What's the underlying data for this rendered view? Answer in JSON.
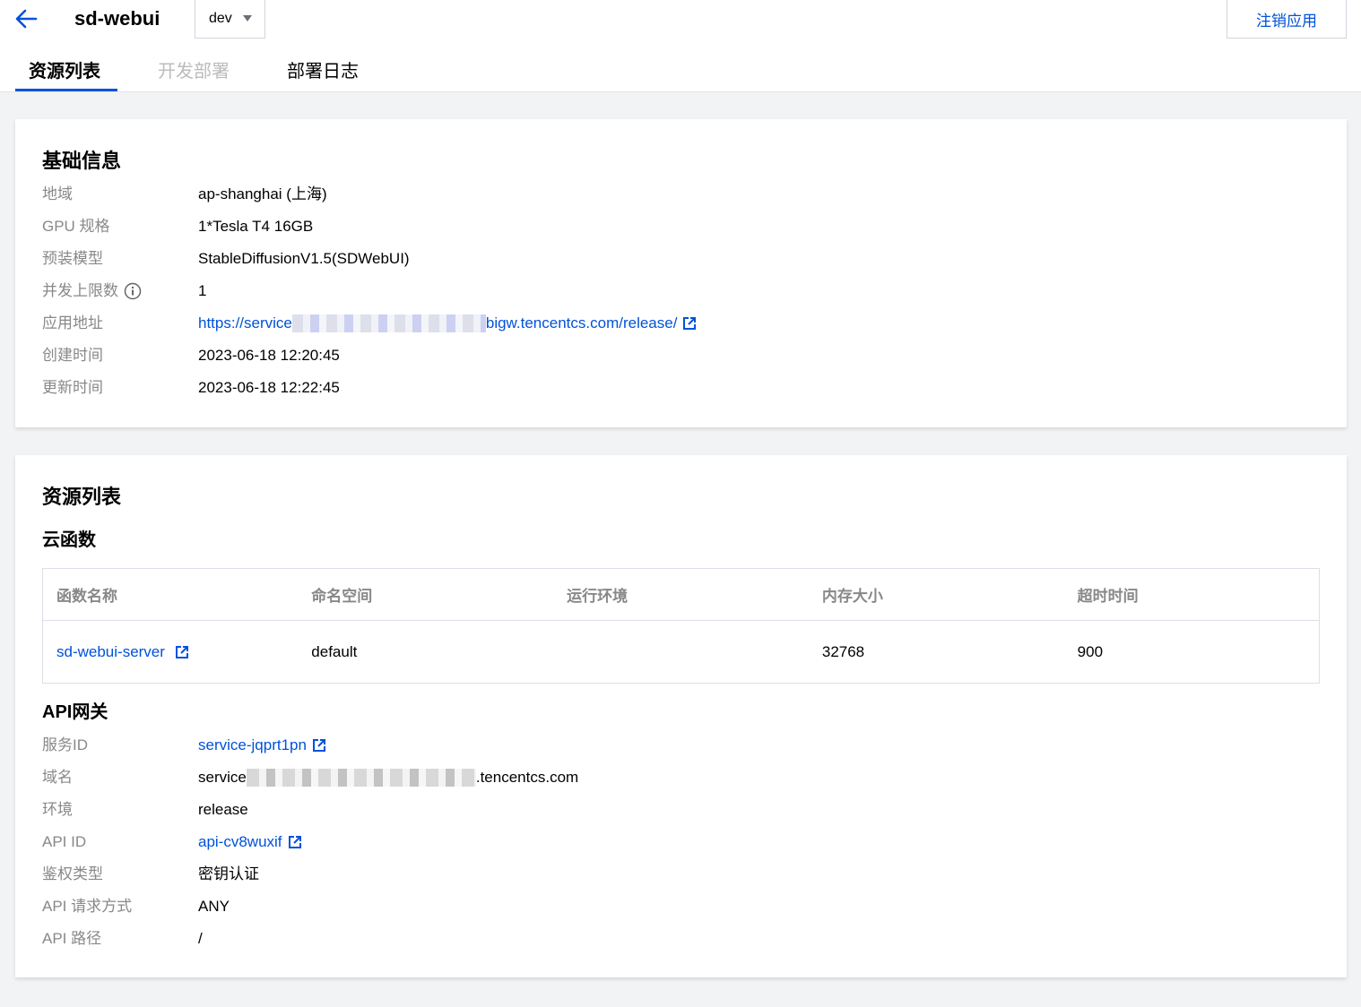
{
  "header": {
    "app_name": "sd-webui",
    "env_selected": "dev",
    "logout_label": "注销应用",
    "tabs": [
      {
        "label": "资源列表",
        "state": "active"
      },
      {
        "label": "开发部署",
        "state": "disabled"
      },
      {
        "label": "部署日志",
        "state": "normal"
      }
    ]
  },
  "basic_info": {
    "title": "基础信息",
    "rows": [
      {
        "label": "地域",
        "value": "ap-shanghai (上海)"
      },
      {
        "label": "GPU 规格",
        "value": "1*Tesla T4 16GB"
      },
      {
        "label": "预装模型",
        "value": "StableDiffusionV1.5(SDWebUI)"
      },
      {
        "label": "并发上限数",
        "value": "1"
      },
      {
        "label": "应用地址",
        "value_prefix": "https://service",
        "value_suffix": "bigw.tencentcs.com/release/"
      },
      {
        "label": "创建时间",
        "value": "2023-06-18 12:20:45"
      },
      {
        "label": "更新时间",
        "value": "2023-06-18 12:22:45"
      }
    ]
  },
  "resources": {
    "title": "资源列表",
    "cloud_function": {
      "title": "云函数",
      "columns": [
        "函数名称",
        "命名空间",
        "运行环境",
        "内存大小",
        "超时时间"
      ],
      "rows": [
        {
          "name": "sd-webui-server",
          "namespace": "default",
          "runtime": "",
          "memory": "32768",
          "timeout": "900"
        }
      ]
    },
    "api_gateway": {
      "title": "API网关",
      "rows": [
        {
          "label": "服务ID",
          "value": "service-jqprt1pn"
        },
        {
          "label": "域名",
          "value_prefix": "service",
          "value_suffix": ".tencentcs.com"
        },
        {
          "label": "环境",
          "value": "release"
        },
        {
          "label": "API ID",
          "value": "api-cv8wuxif"
        },
        {
          "label": "鉴权类型",
          "value": "密钥认证"
        },
        {
          "label": "API 请求方式",
          "value": "ANY"
        },
        {
          "label": "API 路径",
          "value": "/"
        }
      ]
    }
  },
  "colors": {
    "accent": "#0052d9",
    "label_gray": "#888888",
    "page_bg": "#f2f3f5"
  },
  "icons": {
    "back": "arrow-left-icon",
    "external": "external-link-icon",
    "info": "info-circle-icon",
    "dropdown": "caret-down-icon"
  }
}
